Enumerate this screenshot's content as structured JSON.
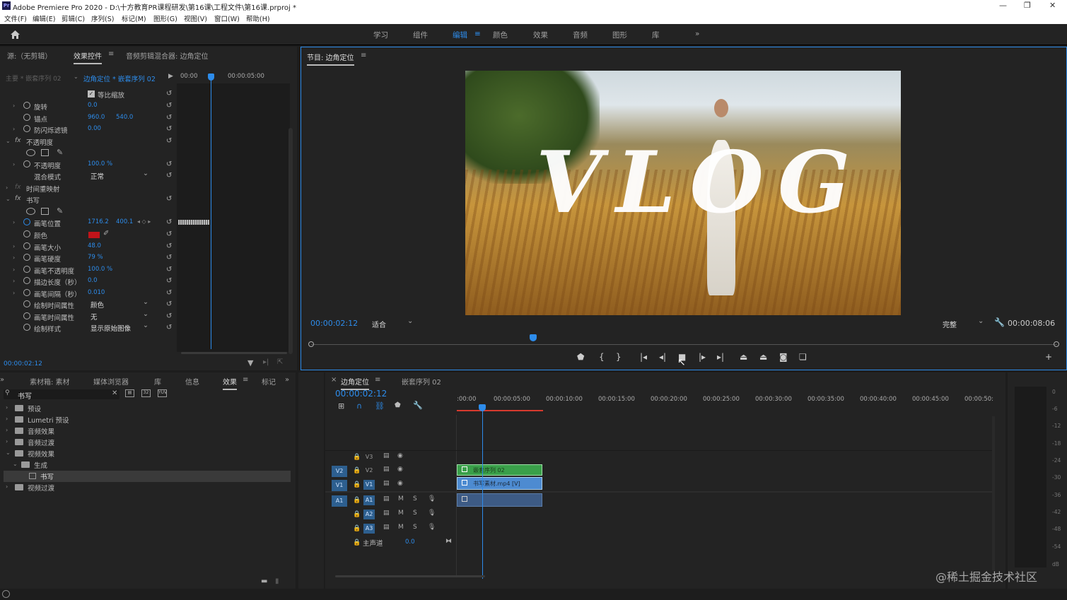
{
  "window": {
    "title": "Adobe Premiere Pro 2020 - D:\\十方教育PR课程研发\\第16课\\工程文件\\第16课.prproj *",
    "app_icon": "Pr",
    "minimize": "—",
    "maximize": "❐",
    "close": "✕"
  },
  "menu": [
    "文件(F)",
    "编辑(E)",
    "剪辑(C)",
    "序列(S)",
    "标记(M)",
    "图形(G)",
    "视图(V)",
    "窗口(W)",
    "帮助(H)"
  ],
  "workspaces": {
    "home_icon": "home-icon",
    "items": [
      "学习",
      "组件",
      "编辑",
      "颜色",
      "效果",
      "音频",
      "图形",
      "库"
    ],
    "active": "编辑",
    "overflow": "»",
    "menu_glyph": "≡"
  },
  "effect_controls": {
    "tabs": [
      "源:（无剪辑）",
      "效果控件",
      "音频剪辑混合器: 边角定位"
    ],
    "source_label": "主要 * 嵌套序列 02",
    "clip_label": "边角定位 * 嵌套序列 02",
    "ruler": [
      "00:00",
      "00:00:05:00"
    ],
    "timecode": "00:00:02:12",
    "rows": [
      {
        "label": "等比缩放",
        "checkbox": true
      },
      {
        "label": "旋转",
        "v1": "0.0"
      },
      {
        "label": "锚点",
        "v1": "960.0",
        "v2": "540.0"
      },
      {
        "label": "防闪烁滤镜",
        "v1": "0.00"
      },
      {
        "label": "不透明度",
        "section": true
      },
      {
        "label": "不透明度",
        "v1": "100.0 %"
      },
      {
        "label": "混合模式",
        "dropdown": "正常"
      },
      {
        "label": "时间重映射",
        "section": true
      },
      {
        "label": "书写",
        "section": true
      },
      {
        "label": "画笔位置",
        "v1": "1716.2",
        "v2": "400.1"
      },
      {
        "label": "颜色",
        "color": "#c0141a"
      },
      {
        "label": "画笔大小",
        "v1": "48.0"
      },
      {
        "label": "画笔硬度",
        "v1": "79 %"
      },
      {
        "label": "画笔不透明度",
        "v1": "100.0 %"
      },
      {
        "label": "描边长度（秒）",
        "v1": "0.0"
      },
      {
        "label": "画笔间隔（秒）",
        "v1": "0.010"
      },
      {
        "label": "绘制时间属性",
        "dropdown": "颜色"
      },
      {
        "label": "画笔时间属性",
        "dropdown": "无"
      },
      {
        "label": "绘制样式",
        "dropdown": "显示原始图像"
      }
    ]
  },
  "program": {
    "title": "节目: 边角定位",
    "timecode": "00:00:02:12",
    "fit": "适合",
    "quality": "完整",
    "duration": "00:00:08:06",
    "overlay_text": "VLOG"
  },
  "project": {
    "tabs": [
      "素材箱: 素材",
      "媒体浏览器",
      "库",
      "信息",
      "效果",
      "标记"
    ],
    "search": "书写",
    "tree": [
      {
        "label": "预设",
        "d": 0
      },
      {
        "label": "Lumetri 预设",
        "d": 0
      },
      {
        "label": "音频效果",
        "d": 0
      },
      {
        "label": "音频过渡",
        "d": 0
      },
      {
        "label": "视频效果",
        "d": 0,
        "open": true
      },
      {
        "label": "生成",
        "d": 1,
        "open": true
      },
      {
        "label": "书写",
        "d": 2,
        "sel": true
      },
      {
        "label": "视频过渡",
        "d": 0
      }
    ]
  },
  "timeline": {
    "tabs": [
      "边角定位",
      "嵌套序列 02"
    ],
    "timecode": "00:00:02:12",
    "ruler": [
      ":00:00",
      "00:00:05:00",
      "00:00:10:00",
      "00:00:15:00",
      "00:00:20:00",
      "00:00:25:00",
      "00:00:30:00",
      "00:00:35:00",
      "00:00:40:00",
      "00:00:45:00",
      "00:00:50:"
    ],
    "tracks": {
      "video": [
        "V3",
        "V2",
        "V1"
      ],
      "audio": [
        "A1",
        "A2",
        "A3"
      ],
      "master": "主声道",
      "master_val": "0.0",
      "src_v": "V1",
      "src_a": "A1"
    },
    "clips": [
      {
        "label": "嵌套序列 02",
        "color": "#3aa04a",
        "track": "V2"
      },
      {
        "label": "书写素材.mp4 [V]",
        "color": "#4d8bd1",
        "track": "V1"
      },
      {
        "label": "",
        "color": "#3d5b85",
        "track": "A1"
      }
    ],
    "track_toggles": {
      "mute": "M",
      "solo": "S"
    }
  },
  "meter_ticks": [
    "0",
    "-6",
    "-12",
    "-18",
    "-24",
    "-30",
    "-36",
    "-42",
    "-48",
    "-54",
    "dB"
  ],
  "watermark": "@稀土掘金技术社区",
  "colors": {
    "accent": "#2d8ceb",
    "panel": "#232323",
    "bg": "#1d1d1d"
  }
}
